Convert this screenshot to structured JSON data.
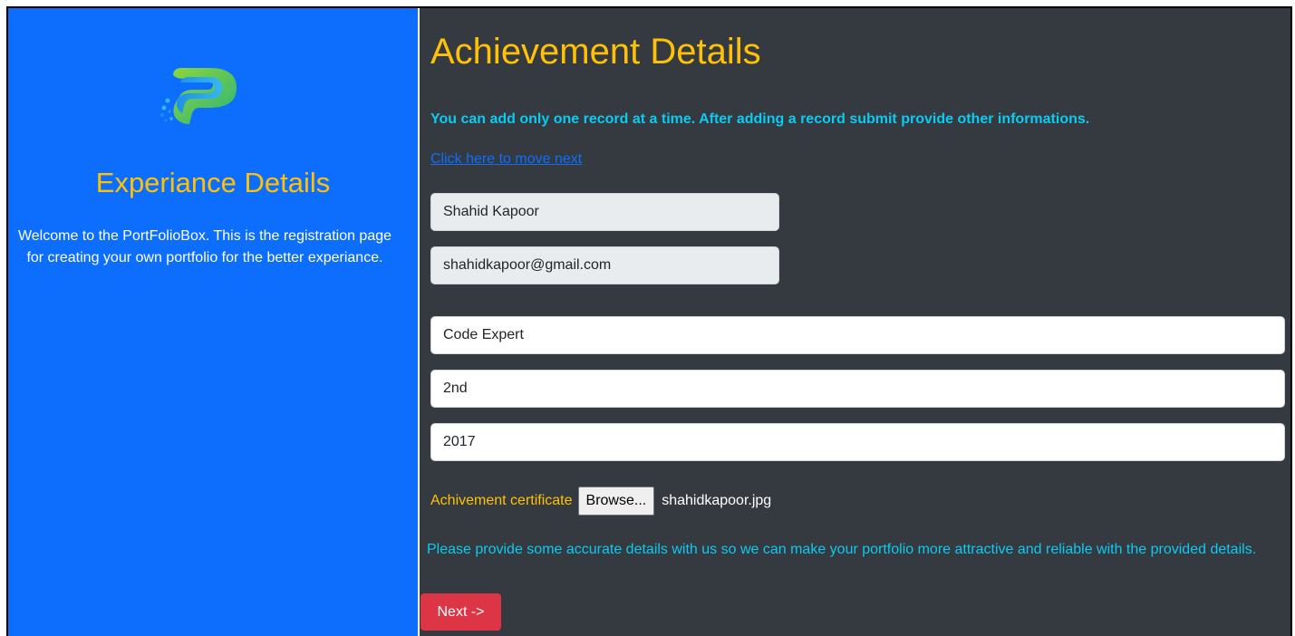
{
  "sidebar": {
    "title": "Experiance Details",
    "description": "Welcome to the PortFolioBox. This is the registration page for creating your own portfolio for the better experiance."
  },
  "main": {
    "heading": "Achievement Details",
    "notice": "You can add only one record at a time. After adding a record submit provide other informations.",
    "next_link": "Click here to move next",
    "fields": {
      "name": "Shahid Kapoor",
      "email": "shahidkapoor@gmail.com",
      "achievement_title": "Code Expert",
      "rank": "2nd",
      "year": "2017"
    },
    "file": {
      "label": "Achivement certificate",
      "button": "Browse...",
      "filename": "shahidkapoor.jpg"
    },
    "info": "Please provide some accurate details with us so we can make your portfolio more attractive and reliable with the provided details.",
    "next_button": "Next ->"
  },
  "colors": {
    "sidebar_bg": "#0d6efd",
    "main_bg": "#343a40",
    "accent_yellow": "#ffc107",
    "accent_cyan": "#0dcaf0",
    "button_red": "#dc3545"
  }
}
